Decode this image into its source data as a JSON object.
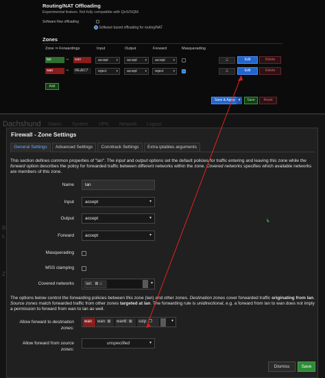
{
  "top_page": {
    "offload_title": "Routing/NAT Offloading",
    "offload_subtitle": "Experimental feature. Not fully compatible with QoS/SQM.",
    "software_flow_label": "Software flow offloading",
    "software_flow_desc": "Software based offloading for routing/NAT",
    "zones_title": "Zones",
    "columns": [
      "Zone ⇒ Forwardings",
      "Input",
      "Output",
      "Forward",
      "Masquerading"
    ],
    "zones": [
      {
        "name": "lan",
        "arrow": "⇒",
        "forward_to": "wan",
        "forward_color": "#8a1c1c",
        "color": "#2f6e2f",
        "input": "accept",
        "output": "accept",
        "forward": "accept",
        "masquerading": false
      },
      {
        "name": "wan",
        "arrow": "⇒",
        "forward_to": "REJECT",
        "forward_color": "#1c1c1c",
        "color": "#8a1c1c",
        "input": "reject",
        "output": "accept",
        "forward": "reject",
        "masquerading": true
      }
    ],
    "drag_label": "☰",
    "edit_label": "Edit",
    "delete_label": "Delete",
    "add_label": "Add",
    "save_apply_label": "Save & Apply",
    "save_label": "Save",
    "reset_label": "Reset"
  },
  "bg_page": {
    "brand": "Dachshund",
    "menu": [
      "Status",
      "System",
      "VPN",
      "Network",
      "Logout"
    ],
    "ghost_r": "R",
    "ghost_e": "E",
    "ghost_z": "Z"
  },
  "modal": {
    "title": "Firewall - Zone Settings",
    "tabs": [
      "General Settings",
      "Advanced Settings",
      "Conntrack Settings",
      "Extra iptables arguments"
    ],
    "description_1": "This section defines common properties of \"lan\". The ",
    "description_input": "input",
    "description_2": " and ",
    "description_output": "output",
    "description_3": " options set the default policies for traffic entering and leaving this zone while the ",
    "description_forward": "forward",
    "description_4": " option describes the policy for forwarded traffic between different networks within the zone. ",
    "description_covered": "Covered networks",
    "description_5": " specifies which available networks are members of this zone.",
    "fields": {
      "name_label": "Name",
      "name_value": "lan",
      "input_label": "Input",
      "input_value": "accept",
      "output_label": "Output",
      "output_value": "accept",
      "forward_label": "Forward",
      "forward_value": "accept",
      "masq_label": "Masquerading",
      "mss_label": "MSS clamping",
      "covered_label": "Covered networks",
      "covered_value": "lan:"
    },
    "fwd_desc_1": "The options below control the forwarding policies between this zone (lan) and other zones. ",
    "fwd_desc_dest": "Destination zones",
    "fwd_desc_2": " cover forwarded traffic ",
    "fwd_desc_orig": "originating from lan",
    "fwd_desc_3": ". ",
    "fwd_desc_src": "Source zones",
    "fwd_desc_4": " match forwarded traffic from other zones ",
    "fwd_desc_target": "targeted at lan",
    "fwd_desc_5": ". The forwarding rule is ",
    "fwd_desc_uni": "unidirectional",
    "fwd_desc_6": ", e.g. a forward from lan to wan does not imply a permission to forward from wan to lan as well.",
    "allow_to_label_a": "Allow forward to ",
    "allow_to_label_b": "destination zones",
    "allow_to_label_c": ":",
    "allow_to_chips": [
      "wan",
      "wan:",
      "wan6:",
      "sstp:"
    ],
    "allow_from_label_a": "Allow forward from ",
    "allow_from_label_b": "source zones",
    "allow_from_label_c": ":",
    "allow_from_value": "unspecified",
    "dismiss_label": "Dismiss",
    "save_label": "Save"
  },
  "colors": {
    "annotation_arrow": "#d42020",
    "accent": "#2266cc",
    "save_green": "#2f8a36"
  }
}
